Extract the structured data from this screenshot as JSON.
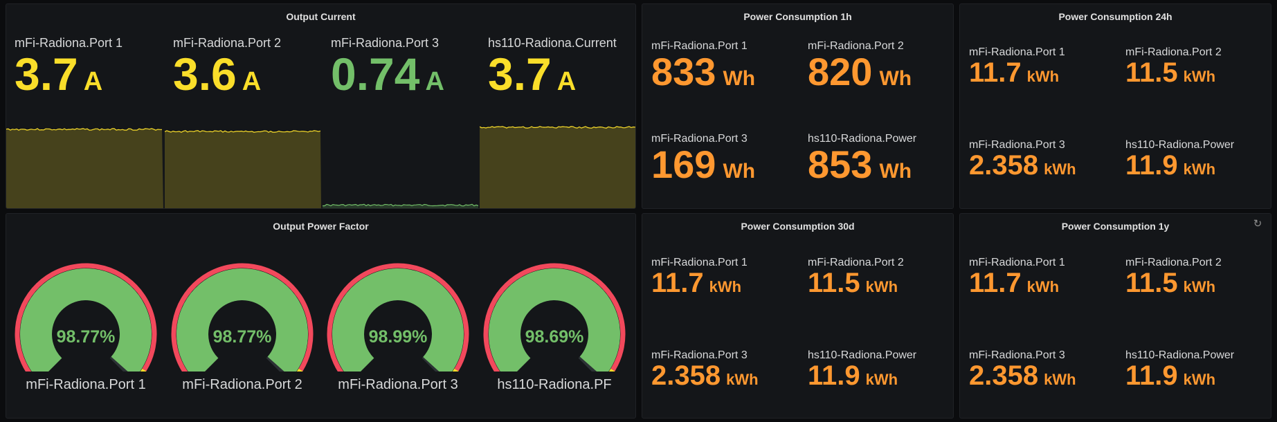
{
  "colors": {
    "yellow": "#fade2a",
    "green": "#73bf69",
    "orange": "#ff9830",
    "red": "#f2495c"
  },
  "output_current": {
    "title": "Output Current",
    "stats": [
      {
        "name": "mFi-Radiona.Port 1",
        "value": "3.7",
        "unit": "A",
        "color": "#fade2a",
        "level": 0.78
      },
      {
        "name": "mFi-Radiona.Port 2",
        "value": "3.6",
        "unit": "A",
        "color": "#fade2a",
        "level": 0.76
      },
      {
        "name": "mFi-Radiona.Port 3",
        "value": "0.74",
        "unit": "A",
        "color": "#73bf69",
        "level": 0.05
      },
      {
        "name": "hs110-Radiona.Current",
        "value": "3.7",
        "unit": "A",
        "color": "#fade2a",
        "level": 0.8
      }
    ]
  },
  "power_factor": {
    "title": "Output Power Factor",
    "gauges": [
      {
        "name": "mFi-Radiona.Port 1",
        "value": "98.77%",
        "fraction": 0.9877
      },
      {
        "name": "mFi-Radiona.Port 2",
        "value": "98.77%",
        "fraction": 0.9877
      },
      {
        "name": "mFi-Radiona.Port 3",
        "value": "98.99%",
        "fraction": 0.9899
      },
      {
        "name": "hs110-Radiona.PF",
        "value": "98.69%",
        "fraction": 0.9869
      }
    ]
  },
  "pc_1h": {
    "title": "Power Consumption 1h",
    "tiles": [
      {
        "name": "mFi-Radiona.Port 1",
        "value": "833",
        "unit": "Wh"
      },
      {
        "name": "mFi-Radiona.Port 2",
        "value": "820",
        "unit": "Wh"
      },
      {
        "name": "mFi-Radiona.Port 3",
        "value": "169",
        "unit": "Wh"
      },
      {
        "name": "hs110-Radiona.Power",
        "value": "853",
        "unit": "Wh"
      }
    ]
  },
  "pc_24h": {
    "title": "Power Consumption 24h",
    "tiles": [
      {
        "name": "mFi-Radiona.Port 1",
        "value": "11.7",
        "unit": "kWh"
      },
      {
        "name": "mFi-Radiona.Port 2",
        "value": "11.5",
        "unit": "kWh"
      },
      {
        "name": "mFi-Radiona.Port 3",
        "value": "2.358",
        "unit": "kWh"
      },
      {
        "name": "hs110-Radiona.Power",
        "value": "11.9",
        "unit": "kWh"
      }
    ]
  },
  "pc_30d": {
    "title": "Power Consumption 30d",
    "tiles": [
      {
        "name": "mFi-Radiona.Port 1",
        "value": "11.7",
        "unit": "kWh"
      },
      {
        "name": "mFi-Radiona.Port 2",
        "value": "11.5",
        "unit": "kWh"
      },
      {
        "name": "mFi-Radiona.Port 3",
        "value": "2.358",
        "unit": "kWh"
      },
      {
        "name": "hs110-Radiona.Power",
        "value": "11.9",
        "unit": "kWh"
      }
    ]
  },
  "pc_1y": {
    "title": "Power Consumption 1y",
    "refresh_icon": "refresh-icon",
    "tiles": [
      {
        "name": "mFi-Radiona.Port 1",
        "value": "11.7",
        "unit": "kWh"
      },
      {
        "name": "mFi-Radiona.Port 2",
        "value": "11.5",
        "unit": "kWh"
      },
      {
        "name": "mFi-Radiona.Port 3",
        "value": "2.358",
        "unit": "kWh"
      },
      {
        "name": "hs110-Radiona.Power",
        "value": "11.9",
        "unit": "kWh"
      }
    ]
  }
}
